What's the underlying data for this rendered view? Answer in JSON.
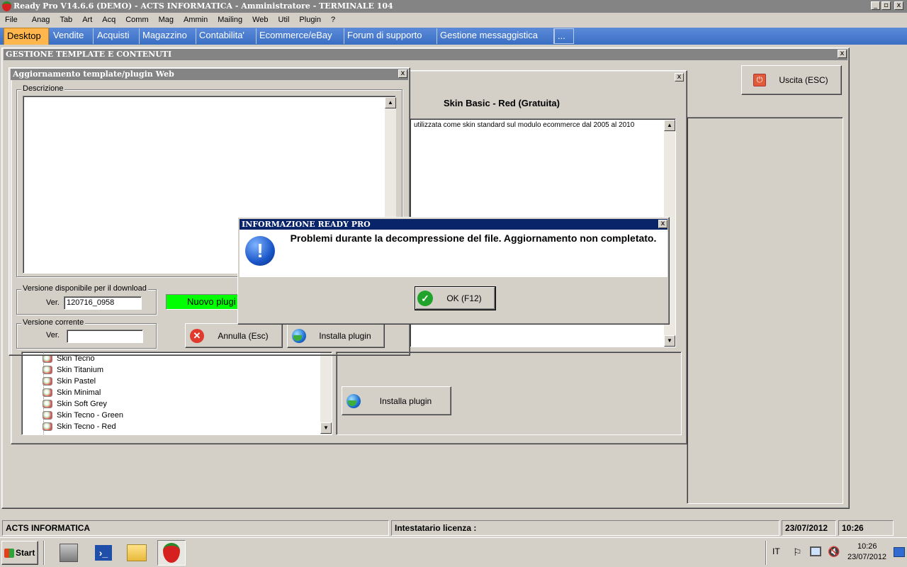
{
  "app": {
    "title": "Ready Pro V14.6.6 (DEMO)  - ACTS INFORMATICA - Amministratore - TERMINALE 104",
    "window_controls": [
      "_",
      "▫",
      "x"
    ]
  },
  "menu": [
    "File",
    "Anag",
    "Tab",
    "Art",
    "Acq",
    "Comm",
    "Mag",
    "Ammin",
    "Mailing",
    "Web",
    "Util",
    "Plugin",
    "?"
  ],
  "tabs": [
    "Desktop",
    "Vendite",
    "Acquisti",
    "Magazzino",
    "Contabilita'",
    "Ecommerce/eBay",
    "Forum di supporto",
    "Gestione messaggistica",
    "..."
  ],
  "main_window": {
    "title": "GESTIONE TEMPLATE E CONTENUTI",
    "exit_button": "Uscita (ESC)",
    "skin_title": "Skin Basic - Red (Gratuita)",
    "skin_description": "utilizzata come skin standard sul modulo ecommerce dal 2005 al 2010",
    "install_button": "Installa plugin",
    "tree_items": [
      "Skin Tecno",
      "Skin Titanium",
      "Skin Pastel",
      "Skin Minimal",
      "Skin Soft Grey",
      "Skin Tecno - Green",
      "Skin Tecno - Red"
    ]
  },
  "update_dialog": {
    "title": "Aggiornamento template/plugin Web",
    "description_label": "Descrizione",
    "download_version_label": "Versione disponibile per il download",
    "ver_label": "Ver.",
    "download_version_value": "120716_0958",
    "status_text": "Nuovo plugi",
    "current_version_label": "Versione corrente",
    "current_ver_label": "Ver.",
    "current_version_value": "",
    "cancel_button": "Annulla (Esc)",
    "install_button": "Installa plugin"
  },
  "info_dialog": {
    "title": "INFORMAZIONE READY PRO",
    "message": "Problemi durante la decompressione del file. Aggiornamento non completato.",
    "ok_button": "OK (F12)"
  },
  "statusbar": {
    "company": "ACTS INFORMATICA",
    "license": "Intestatario licenza :",
    "date": "23/07/2012",
    "time": "10:26"
  },
  "taskbar": {
    "start": "Start",
    "lang": "IT",
    "clock_time": "10:26",
    "clock_date": "23/07/2012"
  },
  "colors": {
    "tab_bar": "#3a6ec4",
    "active_tab": "#ffb74d",
    "dialog_title_active": "#0a246a",
    "progress_green": "#00ff00"
  }
}
